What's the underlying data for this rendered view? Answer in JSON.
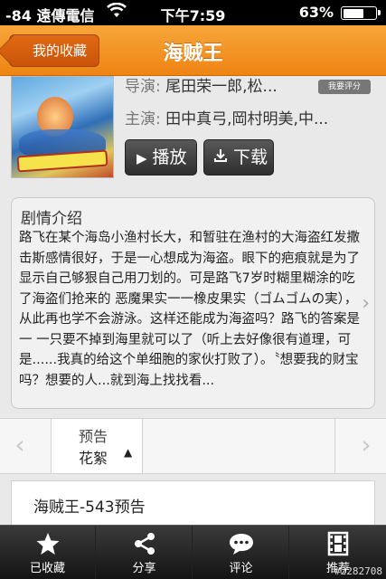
{
  "status_bar": {
    "carrier": "-84 遠傳電信",
    "time": "下午7:59",
    "battery": "63%",
    "battery_level": 0.63
  },
  "nav": {
    "back_label": "我的收藏",
    "title": "海贼王"
  },
  "info": {
    "director_label": "导演:",
    "director_value": "尾田荣一郎,松...",
    "cast_label": "主演:",
    "cast_value": "田中真弓,岡村明美,中...",
    "rate_label": "我要评分",
    "play_label": "播放",
    "download_label": "下载"
  },
  "synopsis": {
    "heading": "剧情介绍",
    "text": "路飞在某个海岛小渔村长大，和暂驻在渔村的大海盗红发撒击斯感情很好，于是一心想成为海盗。眼下的疤痕就是为了显示自己够狠自己用刀划的。可是路飞7岁时糊里糊涂的吃了海盗们抢来的 恶魔果实一一橡皮果实（ゴムゴムの実），从此再也学不会游泳。这样还能成为海盗吗？路飞的答案是一 一只要不掉到海里就可以了（听上去好像很有道理，可是......我真的给这个单细胞的家伙打败了）。〝想要我的财宝吗？想要的人...就到海上找找看..."
  },
  "selector": {
    "tab_line1": "预告",
    "tab_line2": "花絮"
  },
  "episode": {
    "title": "海贼王-543预告"
  },
  "tabbar": {
    "items": [
      {
        "label": "已收藏",
        "icon": "star-icon"
      },
      {
        "label": "分享",
        "icon": "share-icon"
      },
      {
        "label": "评论",
        "icon": "comment-icon"
      },
      {
        "label": "推荐",
        "icon": "film-icon"
      }
    ],
    "watermark": "#2282708"
  }
}
